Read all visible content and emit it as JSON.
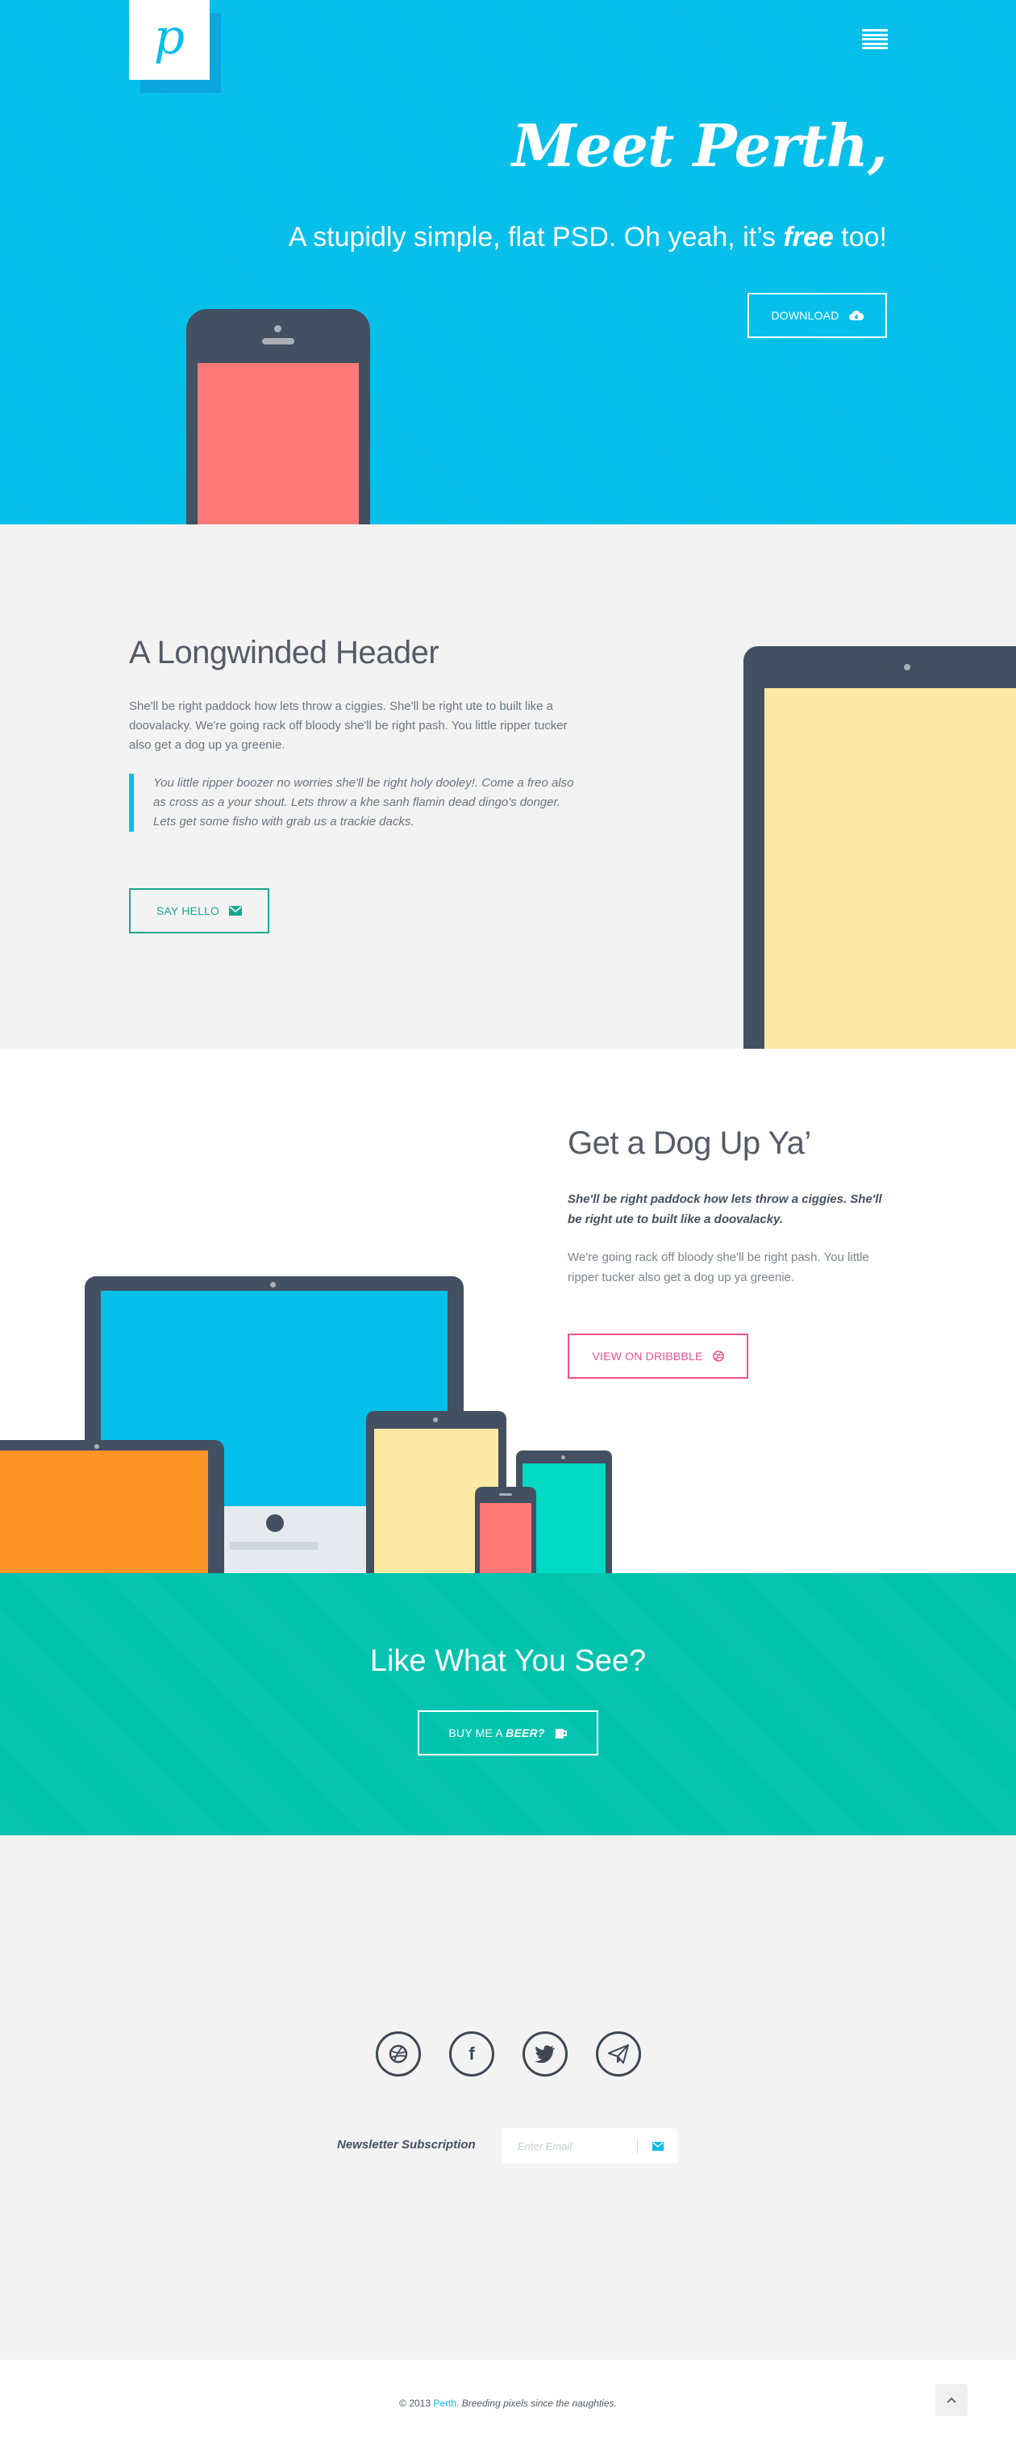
{
  "brand": {
    "logo_letter": "p",
    "accent": "#03bfea"
  },
  "hero": {
    "title": "Meet Perth,",
    "subtitle_pre": "A stupidly simple, flat PSD. Oh yeah, it’s ",
    "subtitle_em": "free",
    "subtitle_post": " too!",
    "download_label": "DOWNLOAD",
    "bg": "#03bfea"
  },
  "section_longwinded": {
    "heading": "A Longwinded Header",
    "paragraph": "She'll be right paddock how lets throw a ciggies. She'll be right ute to built like a doovalacky. We're going rack off bloody she'll be right pash. You little ripper tucker also get a dog up ya greenie.",
    "quote": "You little ripper boozer no worries she'll be right holy dooley!. Come a freo also as cross as a your shout. Lets throw a khe sanh flamin dead dingo's donger. Lets get some fisho with grab us a trackie dacks.",
    "button_label": "SAY HELLO",
    "button_color": "#1aa78f"
  },
  "section_dog": {
    "heading": "Get a Dog Up Ya’",
    "lead": "She'll be right paddock how lets throw a ciggies. She'll be right ute to built like a doovalacky.",
    "paragraph": "We're going rack off bloody she'll be right pash. You little ripper tucker also get a dog up ya greenie.",
    "button_label": "VIEW ON DRIBBBLE",
    "button_color": "#f2508f"
  },
  "cta": {
    "heading": "Like What You See?",
    "button_pre": "BUY ME A ",
    "button_em": "BEER?",
    "bg": "#00c3ae"
  },
  "social": {
    "icons": [
      "dribbble-icon",
      "facebook-icon",
      "twitter-icon",
      "paper-plane-icon"
    ],
    "newsletter_label": "Newsletter Subscription",
    "email_placeholder": "Enter Email"
  },
  "footer": {
    "copyright": "© 2013 ",
    "brand": "Perth.",
    "tagline": " Breeding pixels since the naughties."
  }
}
